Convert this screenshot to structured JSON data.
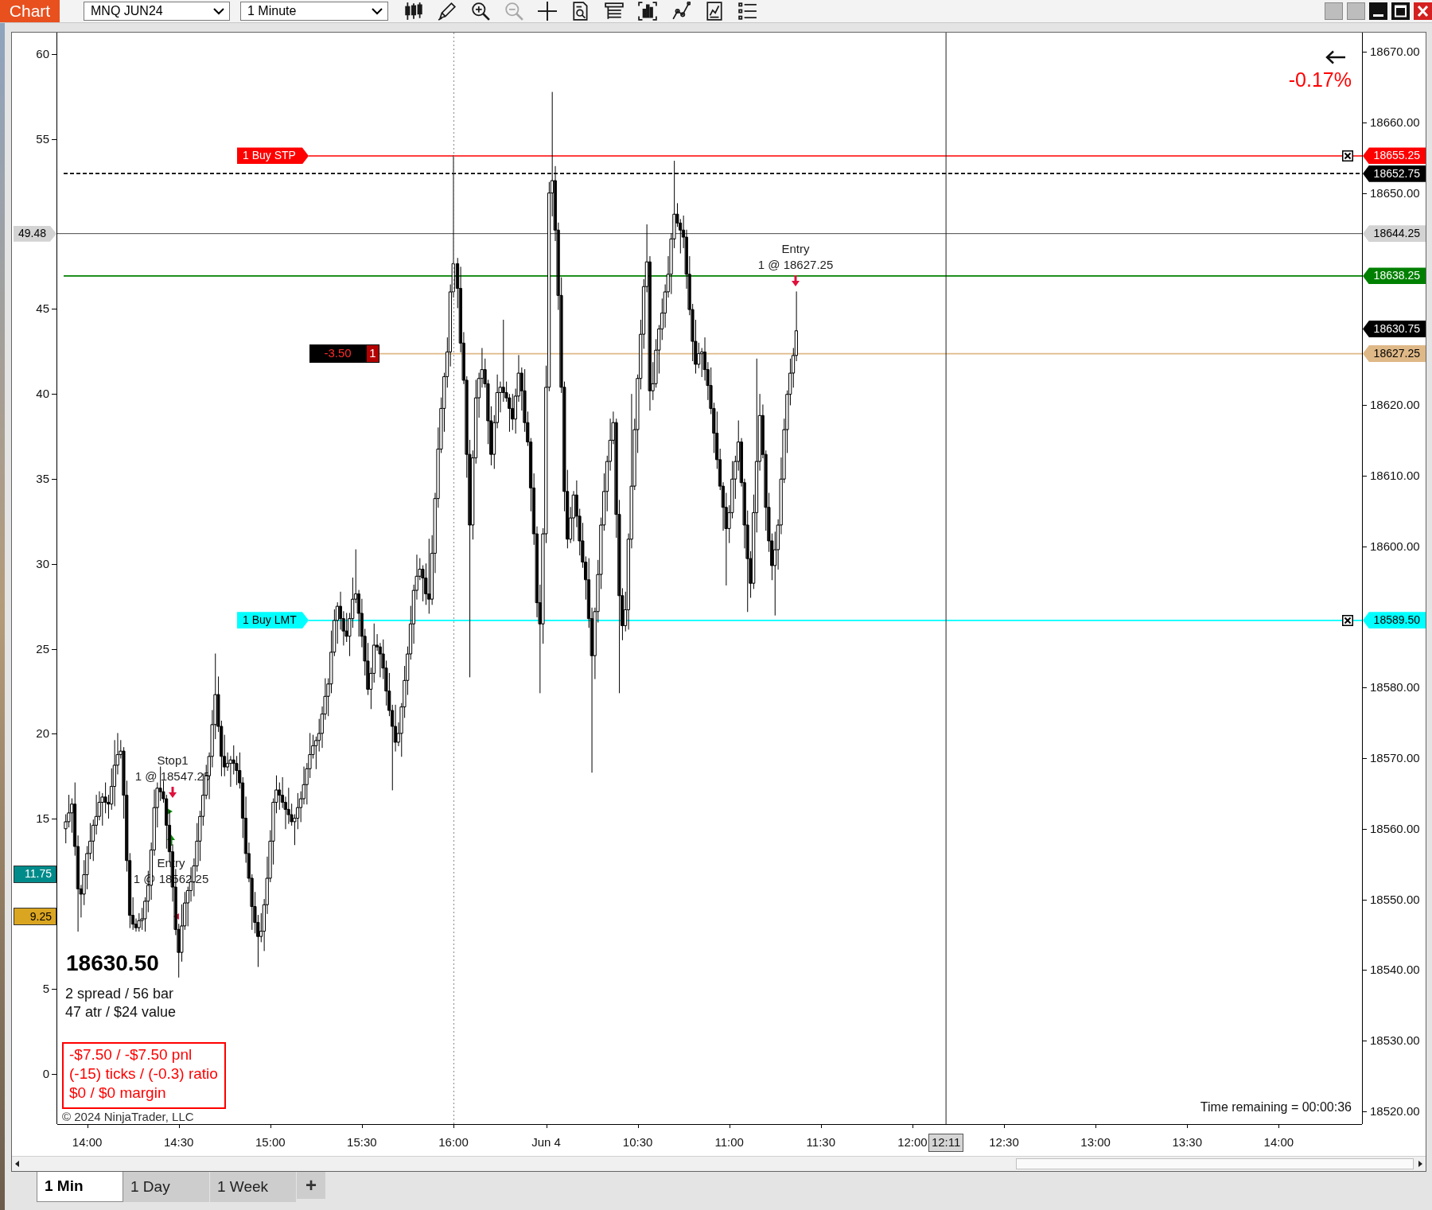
{
  "toolbar": {
    "title": "Chart",
    "instrument": "MNQ JUN24",
    "interval": "1 Minute"
  },
  "chart": {
    "change": "-0.17%",
    "previous_session": {
      "chart_data": {
        "type": "candlestick",
        "xlim": [
          "2024-06-03T13:50:12",
          "2024-06-03T16:00"
        ],
        "ylim": [
          18518.2,
          18672.7
        ],
        "xticks": [
          {
            "value": "2024-06-03T14:00",
            "label": "14:00"
          },
          {
            "value": "2024-06-03T14:30",
            "label": "14:30"
          },
          {
            "value": "2024-06-03T15:00",
            "label": "15:00"
          },
          {
            "value": "2024-06-03T15:30",
            "label": "15:30"
          },
          {
            "value": "2024-06-03T16:00",
            "label": "16:00"
          }
        ],
        "x": [
          "2024-06-03T13:53",
          "2024-06-03T13:54",
          "2024-06-03T13:55",
          "2024-06-03T13:56",
          "2024-06-03T13:57",
          "2024-06-03T13:58",
          "2024-06-03T13:59",
          "2024-06-03T14:00",
          "2024-06-03T14:01",
          "2024-06-03T14:02",
          "2024-06-03T14:03",
          "2024-06-03T14:04",
          "2024-06-03T14:05",
          "2024-06-03T14:06",
          "2024-06-03T14:07",
          "2024-06-03T14:08",
          "2024-06-03T14:09",
          "2024-06-03T14:10",
          "2024-06-03T14:11",
          "2024-06-03T14:12",
          "2024-06-03T14:13",
          "2024-06-03T14:14",
          "2024-06-03T14:15",
          "2024-06-03T14:16",
          "2024-06-03T14:17",
          "2024-06-03T14:18",
          "2024-06-03T14:19",
          "2024-06-03T14:20",
          "2024-06-03T14:21",
          "2024-06-03T14:22",
          "2024-06-03T14:23",
          "2024-06-03T14:24",
          "2024-06-03T14:25",
          "2024-06-03T14:26",
          "2024-06-03T14:27",
          "2024-06-03T14:28",
          "2024-06-03T14:29",
          "2024-06-03T14:30",
          "2024-06-03T14:31",
          "2024-06-03T14:32",
          "2024-06-03T14:33",
          "2024-06-03T14:34",
          "2024-06-03T14:35",
          "2024-06-03T14:36",
          "2024-06-03T14:37",
          "2024-06-03T14:38",
          "2024-06-03T14:39",
          "2024-06-03T14:40",
          "2024-06-03T14:41",
          "2024-06-03T14:42",
          "2024-06-03T14:43",
          "2024-06-03T14:44",
          "2024-06-03T14:45",
          "2024-06-03T14:46",
          "2024-06-03T14:47",
          "2024-06-03T14:48",
          "2024-06-03T14:49",
          "2024-06-03T14:50",
          "2024-06-03T14:51",
          "2024-06-03T14:52",
          "2024-06-03T14:53",
          "2024-06-03T14:54",
          "2024-06-03T14:55",
          "2024-06-03T14:56",
          "2024-06-03T14:57",
          "2024-06-03T14:58",
          "2024-06-03T14:59",
          "2024-06-03T15:00",
          "2024-06-03T15:01",
          "2024-06-03T15:02",
          "2024-06-03T15:03",
          "2024-06-03T15:04",
          "2024-06-03T15:05",
          "2024-06-03T15:06",
          "2024-06-03T15:07",
          "2024-06-03T15:08",
          "2024-06-03T15:09",
          "2024-06-03T15:10",
          "2024-06-03T15:11",
          "2024-06-03T15:12",
          "2024-06-03T15:13",
          "2024-06-03T15:14",
          "2024-06-03T15:15",
          "2024-06-03T15:16",
          "2024-06-03T15:17",
          "2024-06-03T15:18",
          "2024-06-03T15:19",
          "2024-06-03T15:20",
          "2024-06-03T15:21",
          "2024-06-03T15:22",
          "2024-06-03T15:23",
          "2024-06-03T15:24",
          "2024-06-03T15:25",
          "2024-06-03T15:26",
          "2024-06-03T15:27",
          "2024-06-03T15:28",
          "2024-06-03T15:29",
          "2024-06-03T15:30",
          "2024-06-03T15:31",
          "2024-06-03T15:32",
          "2024-06-03T15:33",
          "2024-06-03T15:34",
          "2024-06-03T15:35",
          "2024-06-03T15:36",
          "2024-06-03T15:37",
          "2024-06-03T15:38",
          "2024-06-03T15:39",
          "2024-06-03T15:40",
          "2024-06-03T15:41",
          "2024-06-03T15:42",
          "2024-06-03T15:43",
          "2024-06-03T15:44",
          "2024-06-03T15:45",
          "2024-06-03T15:46",
          "2024-06-03T15:47",
          "2024-06-03T15:48",
          "2024-06-03T15:49",
          "2024-06-03T15:50",
          "2024-06-03T15:51",
          "2024-06-03T15:52",
          "2024-06-03T15:53",
          "2024-06-03T15:54",
          "2024-06-03T15:55",
          "2024-06-03T15:56",
          "2024-06-03T15:57",
          "2024-06-03T15:58",
          "2024-06-03T15:59",
          "2024-06-03T16:00"
        ],
        "ohlc": [
          [
            18560,
            18562,
            18558,
            18561
          ],
          [
            18561,
            18564.75,
            18560.25,
            18562.25
          ],
          [
            18562.25,
            18564.25,
            18559.5,
            18563.5
          ],
          [
            18563.5,
            18566.5,
            18556.25,
            18557.5
          ],
          [
            18557.5,
            18559,
            18545.5,
            18551.5
          ],
          [
            18551.5,
            18552,
            18547.5,
            18550.75
          ],
          [
            18550.75,
            18555.5,
            18549.25,
            18553.5
          ],
          [
            18553.5,
            18557.5,
            18551.5,
            18556.5
          ],
          [
            18556.5,
            18560.75,
            18555.75,
            18558.25
          ],
          [
            18558.25,
            18561.25,
            18555.5,
            18560.5
          ],
          [
            18560.5,
            18564.75,
            18559.25,
            18561.75
          ],
          [
            18561.75,
            18565.25,
            18561.25,
            18563.75
          ],
          [
            18563.75,
            18565,
            18560.5,
            18564.5
          ],
          [
            18564.5,
            18566.5,
            18562.25,
            18563.75
          ],
          [
            18563.75,
            18564.75,
            18561.5,
            18563.5
          ],
          [
            18563.5,
            18568.5,
            18562.75,
            18566
          ],
          [
            18566,
            18572.5,
            18563.25,
            18569
          ],
          [
            18569,
            18573.5,
            18567.75,
            18570.5
          ],
          [
            18570.5,
            18572.5,
            18570,
            18571
          ],
          [
            18571,
            18571.5,
            18561.5,
            18564.75
          ],
          [
            18564.75,
            18566.75,
            18554,
            18555.5
          ],
          [
            18555.5,
            18556.5,
            18546,
            18547.75
          ],
          [
            18547.75,
            18550.25,
            18545.75,
            18546.5
          ],
          [
            18546.5,
            18547.25,
            18545.5,
            18546
          ],
          [
            18546,
            18548,
            18545.5,
            18547
          ],
          [
            18547,
            18548.75,
            18545.75,
            18547.25
          ],
          [
            18547.25,
            18550.25,
            18545.5,
            18549.75
          ],
          [
            18549.75,
            18554,
            18548.25,
            18552
          ],
          [
            18552,
            18558,
            18550,
            18557
          ],
          [
            18557,
            18565.5,
            18556.25,
            18563
          ],
          [
            18563,
            18566.5,
            18560.25,
            18565.75
          ],
          [
            18565.75,
            18568.75,
            18564,
            18565.25
          ],
          [
            18565.25,
            18566.75,
            18563.75,
            18564.25
          ],
          [
            18564.25,
            18564.75,
            18557.25,
            18560.5
          ],
          [
            18560.5,
            18562.5,
            18555.25,
            18556.75
          ],
          [
            18556.75,
            18557.75,
            18549.75,
            18551.75
          ],
          [
            18551.75,
            18554.25,
            18545,
            18545.75
          ],
          [
            18545.75,
            18546.5,
            18539,
            18542.5
          ],
          [
            18542.5,
            18549.25,
            18541.25,
            18546.25
          ],
          [
            18546.25,
            18551,
            18545.75,
            18549.5
          ],
          [
            18549.5,
            18551.75,
            18546.25,
            18551.25
          ],
          [
            18551.25,
            18554.5,
            18549.75,
            18552.5
          ],
          [
            18552.5,
            18555.75,
            18550.5,
            18554.75
          ],
          [
            18554.75,
            18560.75,
            18554,
            18558.25
          ],
          [
            18558.25,
            18562.5,
            18555.5,
            18561.75
          ],
          [
            18561.75,
            18567.75,
            18560.5,
            18564.75
          ],
          [
            18564.75,
            18569,
            18564.25,
            18567.5
          ],
          [
            18567.5,
            18570.75,
            18564.25,
            18570.25
          ],
          [
            18570.25,
            18576.75,
            18568.75,
            18574.75
          ],
          [
            18574.75,
            18584.75,
            18572.75,
            18579
          ],
          [
            18579,
            18581.5,
            18573.75,
            18574.5
          ],
          [
            18574.5,
            18575.25,
            18567.5,
            18570.25
          ],
          [
            18570.25,
            18573.25,
            18567.5,
            18568.75
          ],
          [
            18568.75,
            18570.75,
            18568.25,
            18569.25
          ],
          [
            18569.25,
            18570.25,
            18566,
            18569.75
          ],
          [
            18569.75,
            18571.75,
            18567.75,
            18569.25
          ],
          [
            18569.25,
            18570.25,
            18566.25,
            18568.25
          ],
          [
            18568.25,
            18570.75,
            18565.75,
            18566.5
          ],
          [
            18566.5,
            18567.25,
            18558.75,
            18561.5
          ],
          [
            18561.5,
            18564.5,
            18555.25,
            18556.5
          ],
          [
            18556.5,
            18558,
            18552.5,
            18553
          ],
          [
            18553,
            18553.5,
            18545.75,
            18549
          ],
          [
            18549,
            18551,
            18545.25,
            18546.75
          ],
          [
            18546.75,
            18547.75,
            18540.5,
            18544.75
          ],
          [
            18544.75,
            18548,
            18544,
            18545.5
          ],
          [
            18545.5,
            18550,
            18542.75,
            18549.25
          ],
          [
            18549.25,
            18556,
            18548,
            18553
          ],
          [
            18553,
            18559.75,
            18552.5,
            18558.25
          ],
          [
            18558.25,
            18564.25,
            18555,
            18563.75
          ],
          [
            18563.75,
            18567.5,
            18562.25,
            18565.5
          ],
          [
            18565.5,
            18566.5,
            18562.75,
            18564.75
          ],
          [
            18564.75,
            18567.25,
            18563,
            18563.75
          ],
          [
            18563.75,
            18564.5,
            18560,
            18562.75
          ],
          [
            18562.75,
            18565.75,
            18560.75,
            18562
          ],
          [
            18562,
            18563.5,
            18560.5,
            18561
          ],
          [
            18561,
            18562,
            18557.75,
            18561.5
          ],
          [
            18561.5,
            18565,
            18560,
            18563
          ],
          [
            18563,
            18565.25,
            18561,
            18564.25
          ],
          [
            18564.25,
            18568.75,
            18563.5,
            18566.25
          ],
          [
            18566.25,
            18569.25,
            18563.5,
            18568.5
          ],
          [
            18568.5,
            18573.5,
            18567.25,
            18570.5
          ],
          [
            18570.5,
            18573.25,
            18570,
            18571.75
          ],
          [
            18571.75,
            18573,
            18568.5,
            18572.5
          ],
          [
            18572.5,
            18575.5,
            18571,
            18573.5
          ],
          [
            18573.5,
            18577.25,
            18571.5,
            18576.25
          ],
          [
            18576.25,
            18581.25,
            18575.5,
            18578.75
          ],
          [
            18578.75,
            18581.25,
            18576,
            18580.5
          ],
          [
            18580.5,
            18588,
            18579.25,
            18585
          ],
          [
            18585,
            18591,
            18584.5,
            18589.5
          ],
          [
            18589.5,
            18592,
            18586.25,
            18591.5
          ],
          [
            18591.5,
            18593.5,
            18588.25,
            18589.75
          ],
          [
            18589.75,
            18590.75,
            18586,
            18588
          ],
          [
            18588,
            18590.5,
            18586.5,
            18587.25
          ],
          [
            18587.25,
            18590.5,
            18584.5,
            18589.75
          ],
          [
            18589.75,
            18595.5,
            18588.5,
            18592.5
          ],
          [
            18592.5,
            18599.5,
            18592,
            18593.25
          ],
          [
            18593.25,
            18593.75,
            18587.25,
            18590.5
          ],
          [
            18590.5,
            18592.5,
            18585.75,
            18587.25
          ],
          [
            18587.25,
            18588.25,
            18581.75,
            18583.75
          ],
          [
            18583.75,
            18586.25,
            18579,
            18579.75
          ],
          [
            18579.75,
            18582.75,
            18577,
            18582
          ],
          [
            18582,
            18589,
            18580.75,
            18586
          ],
          [
            18586,
            18587.5,
            18585.25,
            18585.75
          ],
          [
            18585.75,
            18586.25,
            18581.5,
            18584.75
          ],
          [
            18584.75,
            18586.75,
            18581.25,
            18582.75
          ],
          [
            18582.75,
            18583.75,
            18577.5,
            18579.5
          ],
          [
            18579.5,
            18582,
            18576,
            18576.75
          ],
          [
            18576.75,
            18577.5,
            18565.5,
            18574.5
          ],
          [
            18574.5,
            18577.5,
            18571,
            18572.25
          ],
          [
            18572.25,
            18575,
            18571.75,
            18573.5
          ],
          [
            18573.5,
            18577.75,
            18570.25,
            18577.25
          ],
          [
            18577.25,
            18583,
            18575.75,
            18581
          ],
          [
            18581,
            18585.75,
            18579,
            18584.75
          ],
          [
            18584.75,
            18591.5,
            18584,
            18589
          ],
          [
            18589,
            18594.5,
            18586.25,
            18593.75
          ],
          [
            18593.75,
            18598.75,
            18592.5,
            18595.75
          ],
          [
            18595.75,
            18598.25,
            18595.25,
            18596.75
          ],
          [
            18596.75,
            18597.25,
            18592.25,
            18595.5
          ],
          [
            18595.5,
            18597.5,
            18591.75,
            18593.25
          ],
          [
            18593.25,
            18601,
            18590.5,
            18592.5
          ],
          [
            18592.5,
            18601.5,
            18591.75,
            18599
          ],
          [
            18599,
            18607.5,
            18596.25,
            18606.75
          ],
          [
            18606.75,
            18616.75,
            18605.5,
            18613.75
          ],
          [
            18613.75,
            18621,
            18613.25,
            18619.5
          ],
          [
            18619.5,
            18624.5,
            18616.25,
            18624
          ],
          [
            18624,
            18629.5,
            18622.5,
            18627.5
          ],
          [
            18627.5,
            18637,
            18625.5,
            18636
          ],
          [
            18636,
            18655.25,
            18635.25,
            18640
          ]
        ]
      }
    },
    "current_session": {
      "chart_data": {
        "type": "candlestick",
        "xlim": [
          "2024-06-04T09:29:38",
          "2024-06-04T14:27:17"
        ],
        "ylim": [
          18518.2,
          18672.7
        ],
        "xticks": [
          {
            "value": "2024-06-04T10:00",
            "label": "Jun 4"
          },
          {
            "value": "2024-06-04T10:30",
            "label": "10:30"
          },
          {
            "value": "2024-06-04T11:00",
            "label": "11:00"
          },
          {
            "value": "2024-06-04T11:30",
            "label": "11:30"
          },
          {
            "value": "2024-06-04T12:00",
            "label": "12:00"
          },
          {
            "value": "2024-06-04T12:30",
            "label": "12:30"
          },
          {
            "value": "2024-06-04T13:00",
            "label": "13:00"
          },
          {
            "value": "2024-06-04T13:30",
            "label": "13:30"
          },
          {
            "value": "2024-06-04T14:00",
            "label": "14:00"
          }
        ],
        "yticks": [
          {
            "value": 18670,
            "label": "18670.00"
          },
          {
            "value": 18660,
            "label": "18660.00"
          },
          {
            "value": 18650,
            "label": "18650.00"
          },
          {
            "value": 18620,
            "label": "18620.00"
          },
          {
            "value": 18610,
            "label": "18610.00"
          },
          {
            "value": 18600,
            "label": "18600.00"
          },
          {
            "value": 18580,
            "label": "18580.00"
          },
          {
            "value": 18570,
            "label": "18570.00"
          },
          {
            "value": 18560,
            "label": "18560.00"
          },
          {
            "value": 18550,
            "label": "18550.00"
          },
          {
            "value": 18540,
            "label": "18540.00"
          },
          {
            "value": 18530,
            "label": "18530.00"
          },
          {
            "value": 18520,
            "label": "18520.00"
          }
        ],
        "ref_lines": [
          {
            "axis": "x",
            "value": "2024-06-04T12:11",
            "label": "12:11"
          }
        ],
        "x": [
          "2024-06-04T09:31",
          "2024-06-04T09:32",
          "2024-06-04T09:33",
          "2024-06-04T09:34",
          "2024-06-04T09:35",
          "2024-06-04T09:36",
          "2024-06-04T09:37",
          "2024-06-04T09:38",
          "2024-06-04T09:39",
          "2024-06-04T09:40",
          "2024-06-04T09:41",
          "2024-06-04T09:42",
          "2024-06-04T09:43",
          "2024-06-04T09:44",
          "2024-06-04T09:45",
          "2024-06-04T09:46",
          "2024-06-04T09:47",
          "2024-06-04T09:48",
          "2024-06-04T09:49",
          "2024-06-04T09:50",
          "2024-06-04T09:51",
          "2024-06-04T09:52",
          "2024-06-04T09:53",
          "2024-06-04T09:54",
          "2024-06-04T09:55",
          "2024-06-04T09:56",
          "2024-06-04T09:57",
          "2024-06-04T09:58",
          "2024-06-04T09:59",
          "2024-06-04T10:00",
          "2024-06-04T10:01",
          "2024-06-04T10:02",
          "2024-06-04T10:03",
          "2024-06-04T10:04",
          "2024-06-04T10:05",
          "2024-06-04T10:06",
          "2024-06-04T10:07",
          "2024-06-04T10:08",
          "2024-06-04T10:09",
          "2024-06-04T10:10",
          "2024-06-04T10:11",
          "2024-06-04T10:12",
          "2024-06-04T10:13",
          "2024-06-04T10:14",
          "2024-06-04T10:15",
          "2024-06-04T10:16",
          "2024-06-04T10:17",
          "2024-06-04T10:18",
          "2024-06-04T10:19",
          "2024-06-04T10:20",
          "2024-06-04T10:21",
          "2024-06-04T10:22",
          "2024-06-04T10:23",
          "2024-06-04T10:24",
          "2024-06-04T10:25",
          "2024-06-04T10:26",
          "2024-06-04T10:27",
          "2024-06-04T10:28",
          "2024-06-04T10:29",
          "2024-06-04T10:30",
          "2024-06-04T10:31",
          "2024-06-04T10:32",
          "2024-06-04T10:33",
          "2024-06-04T10:34",
          "2024-06-04T10:35",
          "2024-06-04T10:36",
          "2024-06-04T10:37",
          "2024-06-04T10:38",
          "2024-06-04T10:39",
          "2024-06-04T10:40",
          "2024-06-04T10:41",
          "2024-06-04T10:42",
          "2024-06-04T10:43",
          "2024-06-04T10:44",
          "2024-06-04T10:45",
          "2024-06-04T10:46",
          "2024-06-04T10:47",
          "2024-06-04T10:48",
          "2024-06-04T10:49",
          "2024-06-04T10:50",
          "2024-06-04T10:51",
          "2024-06-04T10:52",
          "2024-06-04T10:53",
          "2024-06-04T10:54",
          "2024-06-04T10:55",
          "2024-06-04T10:56",
          "2024-06-04T10:57",
          "2024-06-04T10:58",
          "2024-06-04T10:59",
          "2024-06-04T11:00",
          "2024-06-04T11:01",
          "2024-06-04T11:02",
          "2024-06-04T11:03",
          "2024-06-04T11:04",
          "2024-06-04T11:05",
          "2024-06-04T11:06",
          "2024-06-04T11:07",
          "2024-06-04T11:08",
          "2024-06-04T11:09",
          "2024-06-04T11:10",
          "2024-06-04T11:11",
          "2024-06-04T11:12",
          "2024-06-04T11:13",
          "2024-06-04T11:14",
          "2024-06-04T11:15",
          "2024-06-04T11:16",
          "2024-06-04T11:17",
          "2024-06-04T11:18",
          "2024-06-04T11:19",
          "2024-06-04T11:20",
          "2024-06-04T11:21",
          "2024-06-04T11:22"
        ],
        "ohlc": [
          [
            18640,
            18640.75,
            18633.75,
            18636.5
          ],
          [
            18636.5,
            18639.5,
            18627.5,
            18628.75
          ],
          [
            18628.75,
            18630.25,
            18623,
            18623.5
          ],
          [
            18623.5,
            18624,
            18609.75,
            18613
          ],
          [
            18613,
            18615,
            18581.5,
            18603
          ],
          [
            18603,
            18613.5,
            18601,
            18612.5
          ],
          [
            18612.5,
            18623.5,
            18611.75,
            18621
          ],
          [
            18621,
            18624.5,
            18618.25,
            18623.75
          ],
          [
            18623.75,
            18628,
            18622.5,
            18625
          ],
          [
            18625,
            18626.5,
            18622.5,
            18623
          ],
          [
            18623,
            18623.5,
            18614.5,
            18617.75
          ],
          [
            18617.75,
            18619.75,
            18611.5,
            18613
          ],
          [
            18613,
            18618.5,
            18611,
            18617.5
          ],
          [
            18617.5,
            18624.25,
            18616.75,
            18621.75
          ],
          [
            18621.75,
            18623.25,
            18619,
            18622.5
          ],
          [
            18622.5,
            18632,
            18620.5,
            18621.75
          ],
          [
            18621.75,
            18623.25,
            18620.5,
            18621
          ],
          [
            18621,
            18621.5,
            18616.25,
            18619.5
          ],
          [
            18619.5,
            18621.5,
            18616.5,
            18618
          ],
          [
            18618,
            18622.25,
            18616,
            18621.25
          ],
          [
            18621.25,
            18627,
            18620.5,
            18624.5
          ],
          [
            18624.5,
            18625.25,
            18619.25,
            18622
          ],
          [
            18622,
            18625,
            18616.25,
            18617.5
          ],
          [
            18617.5,
            18619,
            18614.25,
            18614.75
          ],
          [
            18614.75,
            18615.25,
            18605,
            18608.25
          ],
          [
            18608.25,
            18610.25,
            18600.25,
            18601.75
          ],
          [
            18601.75,
            18602.75,
            18590,
            18592
          ],
          [
            18592,
            18594.5,
            18579.25,
            18589
          ],
          [
            18589,
            18602.5,
            18586.25,
            18601.75
          ],
          [
            18601.75,
            18625.5,
            18600.5,
            18622.5
          ],
          [
            18622.5,
            18651.5,
            18622,
            18650
          ],
          [
            18650,
            18664.25,
            18646.75,
            18651.75
          ],
          [
            18651.75,
            18653.75,
            18643.25,
            18644.75
          ],
          [
            18644.75,
            18645.75,
            18633.5,
            18635.5
          ],
          [
            18635.5,
            18638,
            18621.75,
            18622.5
          ],
          [
            18622.5,
            18623.25,
            18605,
            18607.75
          ],
          [
            18607.75,
            18610.75,
            18599.75,
            18601
          ],
          [
            18601,
            18605.5,
            18600.5,
            18604
          ],
          [
            18604,
            18607.75,
            18600.75,
            18607.25
          ],
          [
            18607.25,
            18609.25,
            18602.75,
            18604.25
          ],
          [
            18604.25,
            18605.25,
            18598.75,
            18600.75
          ],
          [
            18600.75,
            18603.25,
            18597,
            18597.75
          ],
          [
            18597.75,
            18598.5,
            18592.5,
            18595.25
          ],
          [
            18595.25,
            18598.25,
            18588.5,
            18589.75
          ],
          [
            18589.75,
            18591.25,
            18568,
            18584.5
          ],
          [
            18584.5,
            18591.25,
            18581.25,
            18590.75
          ],
          [
            18590.75,
            18598,
            18589.25,
            18596
          ],
          [
            18596,
            18604,
            18594,
            18603
          ],
          [
            18603,
            18610.25,
            18602.25,
            18607.75
          ],
          [
            18607.75,
            18612.75,
            18605,
            18612
          ],
          [
            18612,
            18618,
            18610.75,
            18615
          ],
          [
            18615,
            18619,
            18614.5,
            18617.5
          ],
          [
            18617.5,
            18618,
            18601.25,
            18604.5
          ],
          [
            18604.5,
            18606.5,
            18579.25,
            18593
          ],
          [
            18593,
            18594,
            18586.75,
            18588.75
          ],
          [
            18588.75,
            18593.5,
            18588,
            18591
          ],
          [
            18591,
            18601.75,
            18588.25,
            18601
          ],
          [
            18601,
            18621.5,
            18599.75,
            18608.5
          ],
          [
            18608.5,
            18618,
            18608,
            18616.5
          ],
          [
            18616.5,
            18624.25,
            18613.25,
            18623.75
          ],
          [
            18623.75,
            18632,
            18622.25,
            18630
          ],
          [
            18630,
            18637.75,
            18628,
            18636.75
          ],
          [
            18636.75,
            18645.5,
            18636,
            18640.25
          ],
          [
            18640.25,
            18641,
            18619.25,
            18622
          ],
          [
            18622,
            18626,
            18620.75,
            18623
          ],
          [
            18623,
            18629.25,
            18622.5,
            18627.75
          ],
          [
            18627.75,
            18631.25,
            18624.5,
            18630.75
          ],
          [
            18630.75,
            18635,
            18629.25,
            18633
          ],
          [
            18633,
            18637,
            18631,
            18636
          ],
          [
            18636,
            18641,
            18635.25,
            18638.5
          ],
          [
            18638.5,
            18644.25,
            18635.75,
            18643.5
          ],
          [
            18643.5,
            18654.5,
            18642.25,
            18647
          ],
          [
            18647,
            18648.5,
            18645.25,
            18645.75
          ],
          [
            18645.75,
            18646.25,
            18641.5,
            18644.75
          ],
          [
            18644.75,
            18646.75,
            18642.25,
            18643.75
          ],
          [
            18643.75,
            18644.75,
            18636.5,
            18638.5
          ],
          [
            18638.5,
            18641,
            18632.75,
            18633.5
          ],
          [
            18633.5,
            18634.25,
            18626.25,
            18629
          ],
          [
            18629,
            18632,
            18624.5,
            18625.75
          ],
          [
            18625.75,
            18628.75,
            18625.25,
            18627.25
          ],
          [
            18627.25,
            18628,
            18624,
            18627.5
          ],
          [
            18627.5,
            18629.5,
            18623.5,
            18625
          ],
          [
            18625,
            18626,
            18620.75,
            18622.75
          ],
          [
            18622.75,
            18625.25,
            18618.75,
            18619.5
          ],
          [
            18619.5,
            18620.25,
            18613.25,
            18616
          ],
          [
            18616,
            18619,
            18611,
            18612.25
          ],
          [
            18612.25,
            18613.75,
            18608,
            18608.5
          ],
          [
            18608.5,
            18609,
            18602.25,
            18605.5
          ],
          [
            18605.5,
            18607.5,
            18594.5,
            18602.5
          ],
          [
            18602.5,
            18605.75,
            18600.5,
            18604.75
          ],
          [
            18604.75,
            18612,
            18604,
            18609.5
          ],
          [
            18609.5,
            18612.75,
            18606.75,
            18612
          ],
          [
            18612,
            18617.75,
            18610.75,
            18614.75
          ],
          [
            18614.75,
            18615.25,
            18608.5,
            18609
          ],
          [
            18609,
            18609.5,
            18599.75,
            18603
          ],
          [
            18603,
            18605,
            18590.75,
            18598.25
          ],
          [
            18598.25,
            18599.25,
            18592.75,
            18594.75
          ],
          [
            18594.75,
            18607.25,
            18594,
            18604.75
          ],
          [
            18604.75,
            18626.5,
            18602,
            18612
          ],
          [
            18612,
            18621.5,
            18610.75,
            18618.5
          ],
          [
            18618.5,
            18620,
            18612.5,
            18613
          ],
          [
            18613,
            18613.5,
            18602.25,
            18605.5
          ],
          [
            18605.5,
            18607.5,
            18599.25,
            18600.75
          ],
          [
            18600.75,
            18601.75,
            18595.25,
            18597.25
          ],
          [
            18597.25,
            18602,
            18590.25,
            18599.5
          ],
          [
            18599.5,
            18603.75,
            18596.75,
            18603
          ],
          [
            18603,
            18612.5,
            18601.75,
            18609.5
          ],
          [
            18609.5,
            18618,
            18609,
            18616.5
          ],
          [
            18616.5,
            18622,
            18613.25,
            18621.5
          ],
          [
            18621.5,
            18626.5,
            18620,
            18624.5
          ],
          [
            18624.5,
            18628,
            18622.5,
            18627
          ],
          [
            18627,
            18636,
            18626.25,
            18630.5
          ]
        ]
      }
    },
    "left_axis": [
      "60",
      "55",
      "45",
      "40",
      "35",
      "30",
      "25",
      "20",
      "15",
      "5",
      "0"
    ],
    "price_levels": [
      {
        "kind": "order",
        "tag": "1 Buy STP",
        "price": "18655.25",
        "color": "#ff0000"
      },
      {
        "kind": "dashed",
        "price": "18652.75",
        "color": "#000000"
      },
      {
        "kind": "indicator",
        "price": "18644.25",
        "color": "#d3d3d3",
        "left_value": "49.48"
      },
      {
        "kind": "solid",
        "price": "18638.25",
        "color": "#008000"
      },
      {
        "kind": "last",
        "price": "18630.75",
        "color": "#000000"
      },
      {
        "kind": "position",
        "price": "18627.25",
        "color": "#deb887",
        "pnl": "-3.50",
        "quantity": "1"
      },
      {
        "kind": "order",
        "tag": "1 Buy LMT",
        "price": "18589.50",
        "color": "#00ffff"
      }
    ],
    "left_markers": [
      {
        "value": "11.75",
        "color": "#008b8b"
      },
      {
        "value": "9.25",
        "color": "#daa520"
      }
    ],
    "executions": [
      {
        "kind": "sell",
        "title": "Entry",
        "detail": "1 @ 18627.25"
      },
      {
        "kind": "sell",
        "title": "Stop1",
        "detail": "1 @ 18547.25"
      },
      {
        "kind": "buy",
        "title": "Entry",
        "detail": "1 @ 18562.25"
      }
    ],
    "info": {
      "last_price": "18630.50",
      "stats": [
        "2 spread / 56 bar",
        "47 atr / $24 value"
      ]
    },
    "pnl": [
      "-$7.50 / -$7.50 pnl",
      "(-15) ticks / (-0.3) ratio",
      "$0 / $0 margin"
    ],
    "copyright": "© 2024 NinjaTrader, LLC",
    "time_remaining": "Time remaining = 00:00:36"
  },
  "tabs": [
    {
      "label": "1 Min",
      "selected": true
    },
    {
      "label": "1 Day",
      "selected": false
    },
    {
      "label": "1 Week",
      "selected": false
    }
  ],
  "add_tab": "+"
}
